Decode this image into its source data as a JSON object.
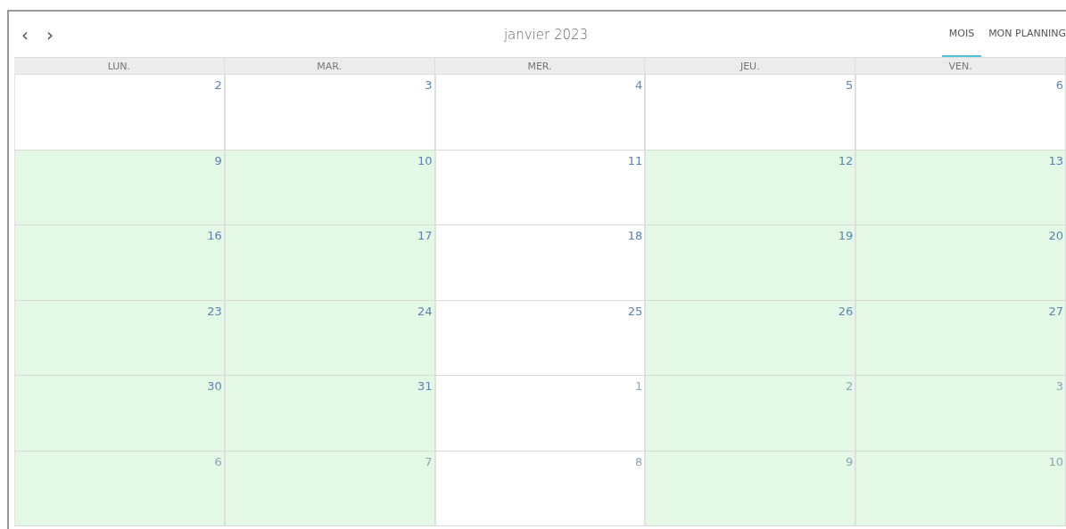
{
  "title": "janvier 2023",
  "nav": [
    "‹",
    "›"
  ],
  "views": [
    {
      "label": "MOIS",
      "selected": true
    },
    {
      "label": "MON PLANNING",
      "selected": false
    }
  ],
  "weekdays": [
    "LUN.",
    "MAR.",
    "MER.",
    "JEU.",
    "VEN."
  ],
  "weeks": [
    {
      "days": [
        {
          "day": "2",
          "highlighted": false,
          "other_month": false
        },
        {
          "day": "3",
          "highlighted": false,
          "other_month": false
        },
        {
          "day": "4",
          "highlighted": false,
          "other_month": false
        },
        {
          "day": "5",
          "highlighted": false,
          "other_month": false
        },
        {
          "day": "6",
          "highlighted": false,
          "other_month": false
        }
      ]
    },
    {
      "days": [
        {
          "day": "9",
          "highlighted": true,
          "other_month": false
        },
        {
          "day": "10",
          "highlighted": true,
          "other_month": false
        },
        {
          "day": "11",
          "highlighted": false,
          "other_month": false
        },
        {
          "day": "12",
          "highlighted": true,
          "other_month": false
        },
        {
          "day": "13",
          "highlighted": true,
          "other_month": false
        }
      ]
    },
    {
      "days": [
        {
          "day": "16",
          "highlighted": true,
          "other_month": false
        },
        {
          "day": "17",
          "highlighted": true,
          "other_month": false
        },
        {
          "day": "18",
          "highlighted": false,
          "other_month": false
        },
        {
          "day": "19",
          "highlighted": true,
          "other_month": false
        },
        {
          "day": "20",
          "highlighted": true,
          "other_month": false
        }
      ]
    },
    {
      "days": [
        {
          "day": "23",
          "highlighted": true,
          "other_month": false
        },
        {
          "day": "24",
          "highlighted": true,
          "other_month": false
        },
        {
          "day": "25",
          "highlighted": false,
          "other_month": false
        },
        {
          "day": "26",
          "highlighted": true,
          "other_month": false
        },
        {
          "day": "27",
          "highlighted": true,
          "other_month": false
        }
      ]
    },
    {
      "days": [
        {
          "day": "30",
          "highlighted": true,
          "other_month": false
        },
        {
          "day": "31",
          "highlighted": true,
          "other_month": false
        },
        {
          "day": "1",
          "highlighted": false,
          "other_month": true
        },
        {
          "day": "2",
          "highlighted": true,
          "other_month": true
        },
        {
          "day": "3",
          "highlighted": true,
          "other_month": true
        }
      ]
    },
    {
      "days": [
        {
          "day": "6",
          "highlighted": true,
          "other_month": true
        },
        {
          "day": "7",
          "highlighted": true,
          "other_month": true
        },
        {
          "day": "8",
          "highlighted": false,
          "other_month": true
        },
        {
          "day": "9",
          "highlighted": true,
          "other_month": true
        },
        {
          "day": "10",
          "highlighted": true,
          "other_month": true
        }
      ]
    }
  ]
}
